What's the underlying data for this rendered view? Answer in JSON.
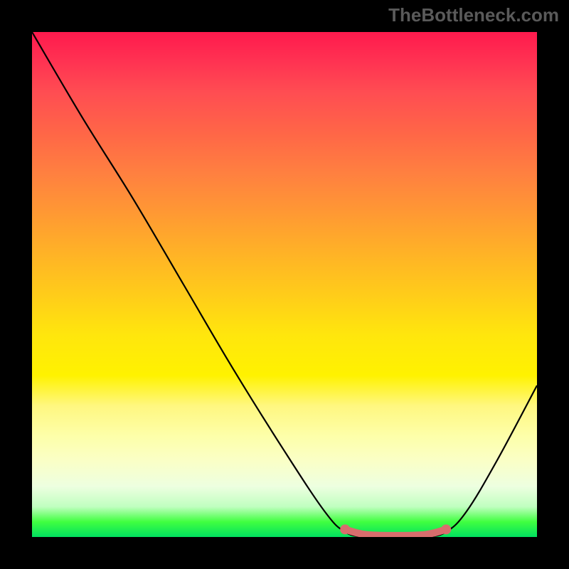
{
  "watermark": "TheBottleneck.com",
  "chart_data": {
    "type": "line",
    "title": "",
    "xlabel": "",
    "ylabel": "",
    "xlim": [
      0,
      100
    ],
    "ylim": [
      0,
      100
    ],
    "series": [
      {
        "name": "bottleneck-curve",
        "points": [
          {
            "x": 0,
            "y": 100
          },
          {
            "x": 10,
            "y": 83
          },
          {
            "x": 20,
            "y": 67
          },
          {
            "x": 30,
            "y": 50
          },
          {
            "x": 40,
            "y": 33
          },
          {
            "x": 50,
            "y": 17
          },
          {
            "x": 58,
            "y": 5
          },
          {
            "x": 62,
            "y": 1
          },
          {
            "x": 66,
            "y": 0
          },
          {
            "x": 72,
            "y": 0
          },
          {
            "x": 78,
            "y": 0
          },
          {
            "x": 82,
            "y": 1
          },
          {
            "x": 86,
            "y": 5
          },
          {
            "x": 92,
            "y": 15
          },
          {
            "x": 100,
            "y": 30
          }
        ]
      },
      {
        "name": "optimal-range-highlight",
        "color": "#d86d6d",
        "points": [
          {
            "x": 62,
            "y": 1.5
          },
          {
            "x": 66,
            "y": 0.5
          },
          {
            "x": 72,
            "y": 0.3
          },
          {
            "x": 78,
            "y": 0.5
          },
          {
            "x": 82,
            "y": 1.5
          }
        ]
      }
    ]
  }
}
